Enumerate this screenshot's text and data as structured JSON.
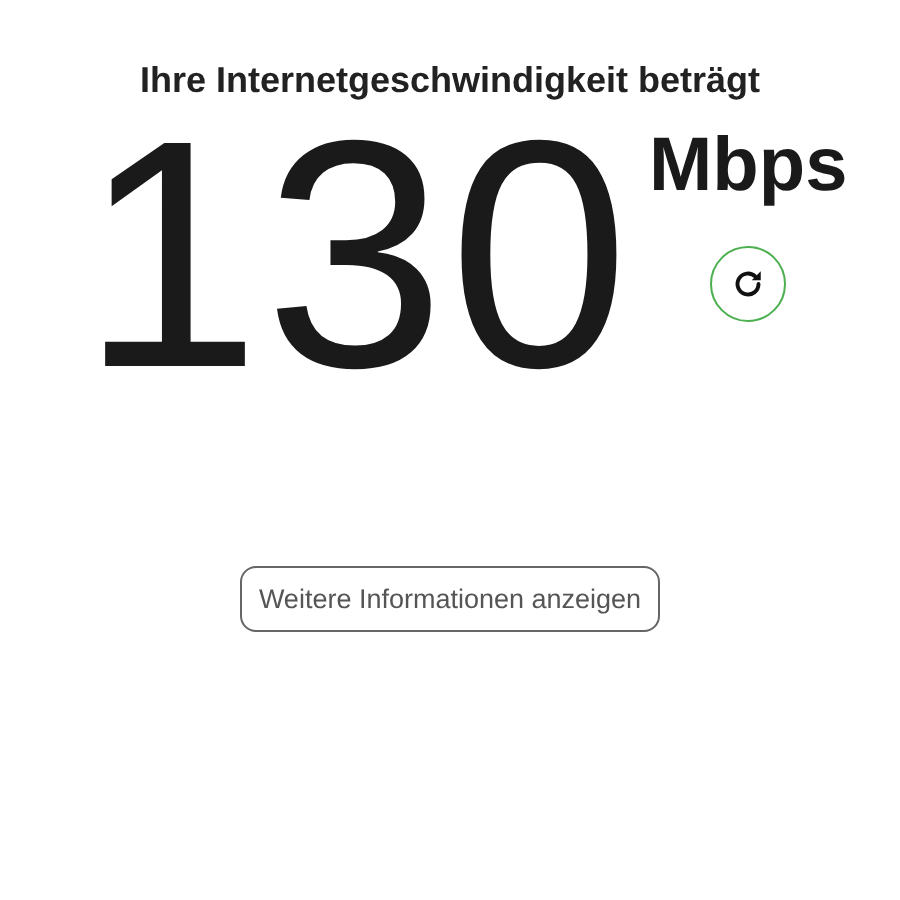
{
  "heading": "Ihre Internetgeschwindigkeit beträgt",
  "speed": {
    "value": "130",
    "unit": "Mbps"
  },
  "more_button": {
    "label": "Weitere Informationen anzeigen"
  }
}
